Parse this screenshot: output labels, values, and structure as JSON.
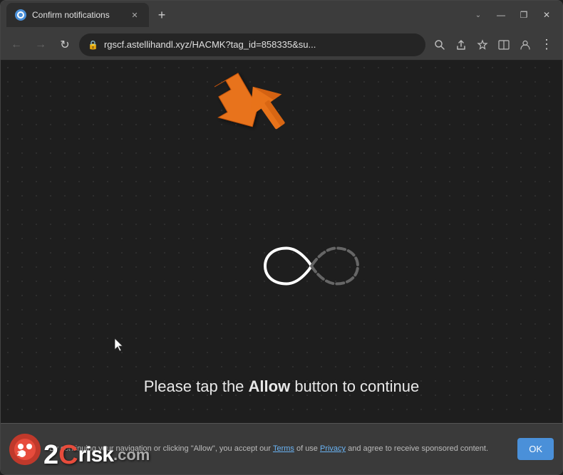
{
  "browser": {
    "tab": {
      "title": "Confirm notifications",
      "favicon_alt": "globe icon"
    },
    "new_tab_label": "+",
    "window_controls": {
      "chevron": "⌄",
      "minimize": "—",
      "maximize": "❐",
      "close": "✕"
    },
    "nav": {
      "back": "←",
      "forward": "→",
      "reload": "↻"
    },
    "address": {
      "url": "rgscf.astellihandl.xyz/HACMK?tag_id=858335&su...",
      "lock": "🔒"
    },
    "toolbar_icons": {
      "search": "🔍",
      "share": "⎋",
      "bookmark": "☆",
      "split": "⊡",
      "profile": "👤",
      "menu": "⋮"
    }
  },
  "page": {
    "main_text_before": "Please tap the ",
    "main_text_bold": "Allow",
    "main_text_after": " button to continue"
  },
  "notification_bar": {
    "text_before": "By continuing your navigation or clicking \"Allow\", you accept our ",
    "link1": "Terms",
    "text_middle": " of use ",
    "link2": "Privacy",
    "text_end": " and agree to receive sponsored content.",
    "ok_label": "OK"
  },
  "watermark": {
    "text_p": "2",
    "text_c": "C",
    "text_risk": "risk",
    "text_com": ".com"
  }
}
